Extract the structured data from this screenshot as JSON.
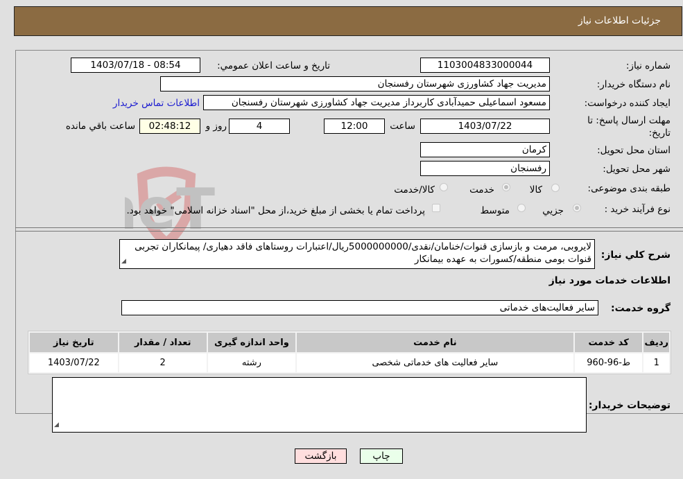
{
  "header": {
    "title": "جزئیات اطلاعات نیاز"
  },
  "form": {
    "need_number": {
      "label": "شماره نیاز:",
      "value": "1103004833000044"
    },
    "announce_datetime": {
      "label": "تاریخ و ساعت اعلان عمومي:",
      "value": "1403/07/18 - 08:54"
    },
    "buyer_org": {
      "label": "نام دستگاه خریدار:",
      "value": "مدیریت جهاد کشاورزی شهرستان رفسنجان"
    },
    "requester": {
      "label": "ایجاد کننده درخواست:",
      "value": "مسعود اسماعیلی حمیدآبادی کاربرداز مدیریت جهاد کشاورزی شهرستان رفسنجان",
      "contact_link": "اطلاعات تماس خریدار"
    },
    "deadline": {
      "label": "مهلت ارسال پاسخ: تا تاریخ:",
      "date": "1403/07/22",
      "time_label": "ساعت",
      "time": "12:00",
      "days": "4",
      "days_label": "روز و",
      "remaining": "02:48:12",
      "remaining_label": "ساعت باقي مانده"
    },
    "province": {
      "label": "استان محل تحویل:",
      "value": "کرمان"
    },
    "city": {
      "label": "شهر محل تحویل:",
      "value": "رفسنجان"
    },
    "category": {
      "label": "طبقه بندی موضوعی:",
      "options": [
        "کالا",
        "خدمت",
        "کالا/خدمت"
      ],
      "selected": "خدمت"
    },
    "purchase_type": {
      "label": "نوع فرآیند خرید :",
      "options": [
        "جزیي",
        "متوسط"
      ],
      "selected": "جزیي",
      "treasury_note": "پرداخت تمام یا بخشی از مبلغ خرید،از محل \"اسناد خزانه اسلامی\" خواهد بود.",
      "treasury_checked": false
    },
    "description": {
      "label": "شرح کلي نیاز:",
      "value": "لایروبی، مرمت و بازسازی قنوات/خنامان/نقدی/5000000000ریال/اعتبارات روستاهای فاقد دهیاری/ پیمانکاران تجربی قنوات بومی منطقه/کسورات به عهده بیمانکار"
    },
    "services_section_title": "اطلاعات خدمات مورد نیاز",
    "service_group": {
      "label": "گروه خدمت:",
      "value": "سایر فعالیت‌های خدماتی"
    }
  },
  "table": {
    "headers": [
      "ردیف",
      "کد خدمت",
      "نام خدمت",
      "واحد اندازه گیری",
      "تعداد / مقدار",
      "تاریخ نیاز"
    ],
    "rows": [
      [
        "1",
        "ط-96-960",
        "سایر فعالیت های خدماتی شخصی",
        "رشته",
        "2",
        "1403/07/22"
      ]
    ]
  },
  "buyer_notes": {
    "label": "توضیحات خریدار:",
    "value": ""
  },
  "buttons": {
    "print": "چاپ",
    "back": "بازگشت"
  },
  "watermark": {
    "text": "AriaTender.neT"
  }
}
